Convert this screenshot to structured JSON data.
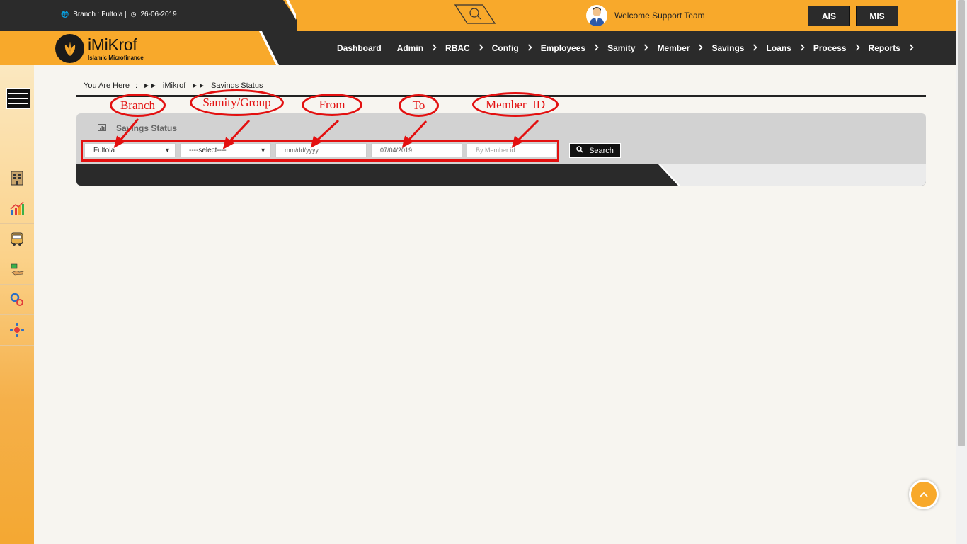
{
  "topbar": {
    "branch_info": "Branch : Fultola |",
    "date": "26-06-2019",
    "welcome": "Welcome Support Team",
    "ais_label": "AIS",
    "mis_label": "MIS"
  },
  "logo": {
    "name": "iMiKrof",
    "tagline": "Islamic Microfinance"
  },
  "nav": {
    "items": [
      {
        "label": "Dashboard",
        "has_submenu": false
      },
      {
        "label": "Admin",
        "has_submenu": true
      },
      {
        "label": "RBAC",
        "has_submenu": true
      },
      {
        "label": "Config",
        "has_submenu": true
      },
      {
        "label": "Employees",
        "has_submenu": true
      },
      {
        "label": "Samity",
        "has_submenu": true
      },
      {
        "label": "Member",
        "has_submenu": true
      },
      {
        "label": "Savings",
        "has_submenu": true
      },
      {
        "label": "Loans",
        "has_submenu": true
      },
      {
        "label": "Process",
        "has_submenu": true
      },
      {
        "label": "Reports",
        "has_submenu": true
      }
    ]
  },
  "sidebar": {
    "icons": [
      "building-icon",
      "chart-growth-icon",
      "bus-icon",
      "hand-money-icon",
      "gears-icon",
      "network-icon"
    ]
  },
  "breadcrumb": {
    "prefix": "You Are Here",
    "colon": ":",
    "home": "iMikrof",
    "current": "Savings Status"
  },
  "panel": {
    "title": "Savings Status",
    "branch_value": "Fultola",
    "samity_value": "----select----",
    "from_placeholder": "mm/dd/yyyy",
    "to_value": "07/04/2019",
    "member_placeholder": "By Member id",
    "search_label": "Search"
  },
  "annotations": {
    "branch": "Branch",
    "samity": "Samity/Group",
    "from": "From",
    "to": "To",
    "member": "Member  ID"
  },
  "colors": {
    "accent": "#f8a92b",
    "dark": "#2b2b2b",
    "annotation_red": "#e31010"
  }
}
